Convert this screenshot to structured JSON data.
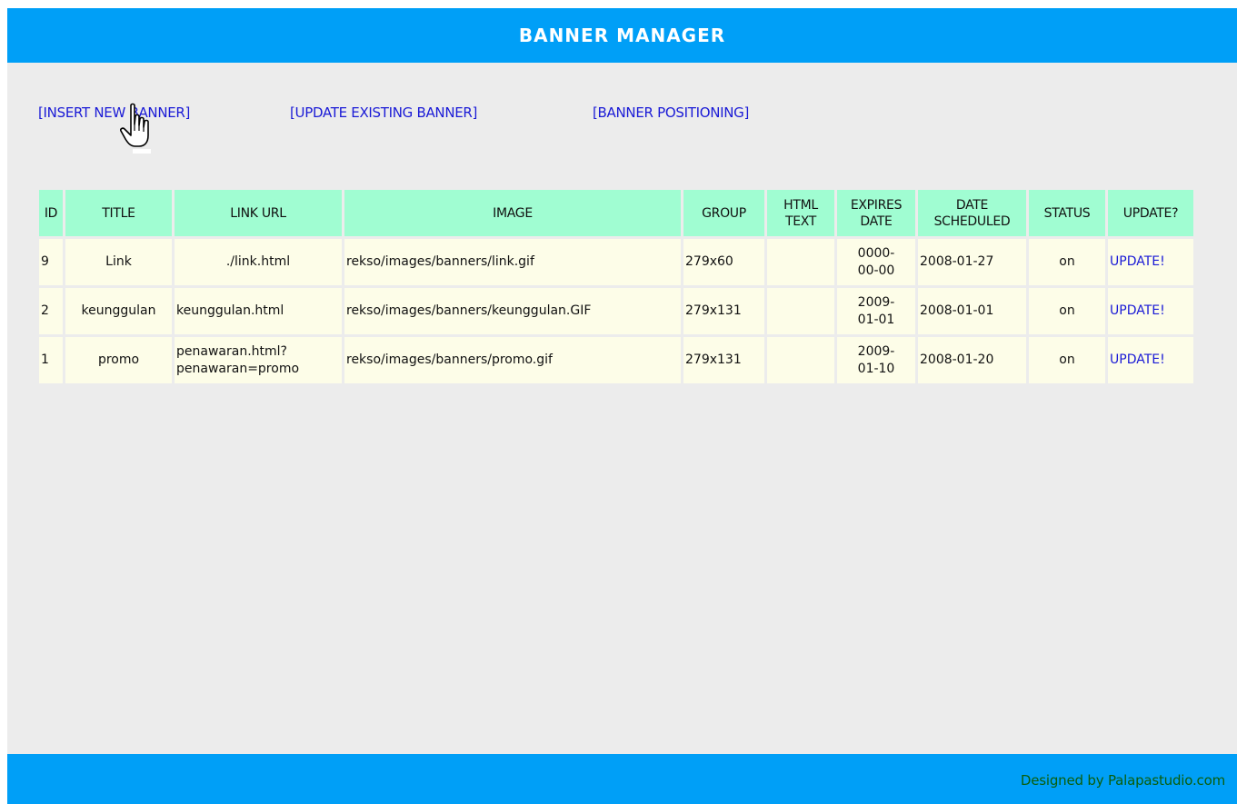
{
  "header": {
    "title": "BANNER MANAGER"
  },
  "nav": {
    "insert": "[INSERT NEW BANNER]",
    "update_existing": "[UPDATE EXISTING BANNER]",
    "positioning": "[BANNER POSITIONING]"
  },
  "table": {
    "headers": {
      "id": "ID",
      "title": "TITLE",
      "link_url": "LINK URL",
      "image": "IMAGE",
      "group": "GROUP",
      "html_text_1": "HTML",
      "html_text_2": "TEXT",
      "expires_1": "EXPIRES",
      "expires_2": "DATE",
      "scheduled_1": "DATE",
      "scheduled_2": "SCHEDULED",
      "status": "STATUS",
      "update": "UPDATE?"
    },
    "rows": [
      {
        "id": "9",
        "title": "Link",
        "link_url_1": "./link.html",
        "link_url_2": "",
        "image": "rekso/images/banners/link.gif",
        "group": "279x60",
        "html_text": "",
        "expires_1": "0000-",
        "expires_2": "00-00",
        "scheduled": "2008-01-27",
        "status": "on",
        "update": "UPDATE!"
      },
      {
        "id": "2",
        "title": "keunggulan",
        "link_url_1": "keunggulan.html",
        "link_url_2": "",
        "image": "rekso/images/banners/keunggulan.GIF",
        "group": "279x131",
        "html_text": "",
        "expires_1": "2009-",
        "expires_2": "01-01",
        "scheduled": "2008-01-01",
        "status": "on",
        "update": "UPDATE!"
      },
      {
        "id": "1",
        "title": "promo",
        "link_url_1": "penawaran.html?",
        "link_url_2": "penawaran=promo",
        "image": "rekso/images/banners/promo.gif",
        "group": "279x131",
        "html_text": "",
        "expires_1": "2009-",
        "expires_2": "01-10",
        "scheduled": "2008-01-20",
        "status": "on",
        "update": "UPDATE!"
      }
    ]
  },
  "footer": {
    "credit": "Designed by Palapastudio.com"
  },
  "colors": {
    "bar": "#009ff7",
    "page_bg": "#ececec",
    "header_cell": "#a0fdd2",
    "data_cell": "#fdfde8",
    "link": "#1a1ad6",
    "footer_text": "#0b5e0b"
  },
  "icons": {
    "cursor": "hand-pointer-icon"
  }
}
